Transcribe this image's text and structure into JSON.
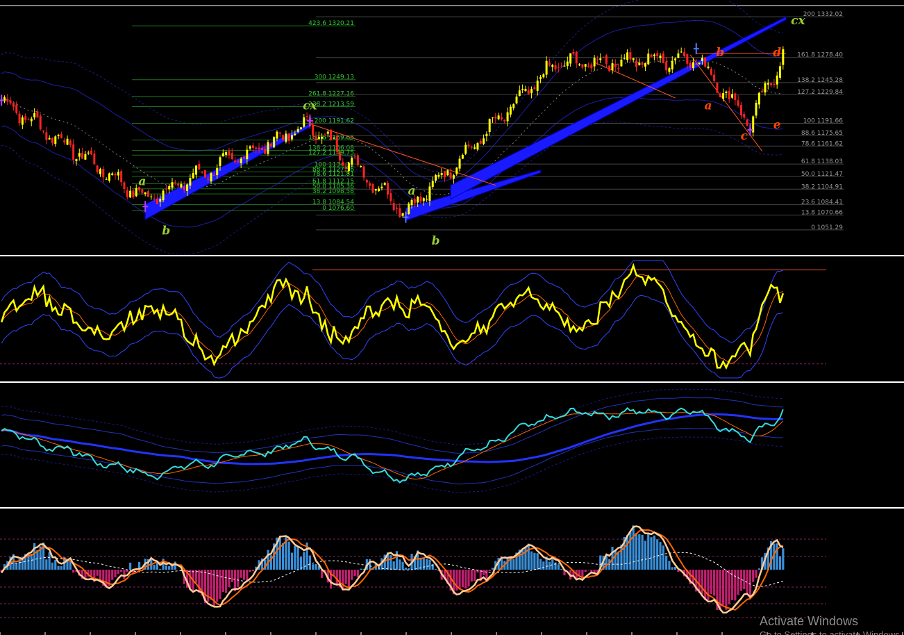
{
  "chart_data": {
    "type": "line",
    "panels": [
      {
        "name": "price",
        "ylim": [
          1020,
          1345
        ],
        "fib_levels_left": [
          {
            "label": "423.6 1320.21",
            "value": 1320.21
          },
          {
            "label": "300 1249.13",
            "value": 1249.13
          },
          {
            "label": "261.8 1227.16",
            "value": 1227.16
          },
          {
            "label": "238.2 1213.59",
            "value": 1213.59
          },
          {
            "label": "200 1191.62",
            "value": 1191.62
          },
          {
            "label": "161.8 1169.65",
            "value": 1169.65
          },
          {
            "label": "138.2 1156.08",
            "value": 1156.08
          },
          {
            "label": "127.2 1149.75",
            "value": 1149.75
          },
          {
            "label": "100 1134.11",
            "value": 1134.11
          },
          {
            "label": "88.6 1127.56",
            "value": 1127.56
          },
          {
            "label": "78.6 1121.81",
            "value": 1121.81
          },
          {
            "label": "61.8 1112.15",
            "value": 1112.15
          },
          {
            "label": "50.0 1105.36",
            "value": 1105.36
          },
          {
            "label": "38.2 1098.58",
            "value": 1098.58
          },
          {
            "label": "13.8 1084.54",
            "value": 1084.54
          },
          {
            "label": "0 1076.60",
            "value": 1076.6
          }
        ],
        "fib_levels_right": [
          {
            "label": "200 1332.02",
            "value": 1332.02
          },
          {
            "label": "161.8 1278.40",
            "value": 1278.4
          },
          {
            "label": "138.2 1245.28",
            "value": 1245.28
          },
          {
            "label": "127.2 1229.84",
            "value": 1229.84
          },
          {
            "label": "100 1191.66",
            "value": 1191.66
          },
          {
            "label": "88.6 1175.65",
            "value": 1175.65
          },
          {
            "label": "78.6 1161.62",
            "value": 1161.62
          },
          {
            "label": "61.8 1138.03",
            "value": 1138.03
          },
          {
            "label": "50.0 1121.47",
            "value": 1121.47
          },
          {
            "label": "38.2 1104.91",
            "value": 1104.91
          },
          {
            "label": "23.6 1084.41",
            "value": 1084.41
          },
          {
            "label": "13.8 1070.66",
            "value": 1070.66
          },
          {
            "label": "0 1051.29",
            "value": 1051.29
          }
        ],
        "wave_labels": [
          {
            "text": "a",
            "bar": 47,
            "value": 1110,
            "color": "#9acd32"
          },
          {
            "text": "b",
            "bar": 55,
            "value": 1045,
            "color": "#9acd32"
          },
          {
            "text": "cx",
            "bar": 103,
            "value": 1210,
            "color": "#9acd32"
          },
          {
            "text": "a",
            "bar": 137,
            "value": 1098,
            "color": "#9acd32"
          },
          {
            "text": "b",
            "bar": 145,
            "value": 1032,
            "color": "#9acd32"
          },
          {
            "text": "b",
            "bar": 240,
            "value": 1280,
            "color": "#ff4500"
          },
          {
            "text": "d",
            "bar": 259,
            "value": 1280,
            "color": "#ff4500"
          },
          {
            "text": "cx",
            "bar": 266,
            "value": 1322,
            "color": "#9acd32"
          },
          {
            "text": "a",
            "bar": 236,
            "value": 1210,
            "color": "#ff4500"
          },
          {
            "text": "c",
            "bar": 248,
            "value": 1170,
            "color": "#ff4500"
          },
          {
            "text": "e",
            "bar": 259,
            "value": 1185,
            "color": "#ff4500"
          }
        ],
        "pivots": [
          {
            "bar": 0,
            "value": 1222
          },
          {
            "bar": 48,
            "value": 1092
          },
          {
            "bar": 103,
            "value": 1190
          },
          {
            "bar": 135,
            "value": 1075
          },
          {
            "bar": 185,
            "value": 1270
          },
          {
            "bar": 232,
            "value": 1278
          },
          {
            "bar": 250,
            "value": 1193
          },
          {
            "bar": 261,
            "value": 1282
          }
        ],
        "bar_count": 262
      },
      {
        "name": "oscillator",
        "ylim": [
          0,
          100
        ],
        "line_colors": {
          "main": "#ffff00",
          "signal": "#ff6600",
          "bands": "#3344ff"
        },
        "levels": [
          70,
          30
        ]
      },
      {
        "name": "ma_bands",
        "line_colors": {
          "main": "#33dddd",
          "signal": "#ff6600",
          "slow": "#2233ff"
        }
      },
      {
        "name": "histogram",
        "colors": {
          "positive": "#3a8fd8",
          "negative": "#c0206f",
          "fast": "#ffcc99",
          "slow": "#ff6600",
          "signal": "#ffffff"
        }
      }
    ]
  },
  "overlay": {
    "watermark_title": "Activate Windows",
    "watermark_sub": "Go to Settings to activate Windows."
  },
  "colors": {
    "background": "#000000",
    "bull_candle": "#ffff00",
    "bear_candle": "#ff2222",
    "pattern_fill": "#1a1aff",
    "fib_left": "#33cc33",
    "fib_right": "#999999",
    "separator": "#ffffff"
  }
}
